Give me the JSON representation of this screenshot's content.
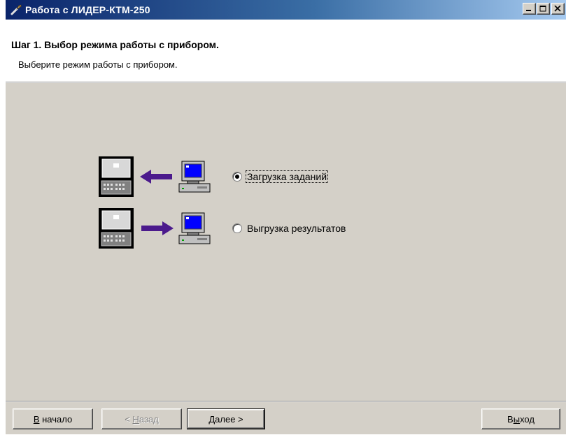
{
  "window": {
    "title": "Работа с ЛИДЕР-КТМ-250",
    "controls": [
      "minimize-icon",
      "maximize-icon",
      "close-icon"
    ]
  },
  "header": {
    "title": "Шаг 1. Выбор режима работы с прибором.",
    "subtitle": "Выберите режим работы с прибором."
  },
  "options": [
    {
      "label": "Загрузка заданий",
      "selected": true,
      "icons": [
        "device-icon",
        "arrow-left-icon",
        "computer-icon"
      ]
    },
    {
      "label": "Выгрузка результатов",
      "selected": false,
      "icons": [
        "device-icon",
        "arrow-right-icon",
        "computer-icon"
      ]
    }
  ],
  "buttons": {
    "home": {
      "mnemonic": "В",
      "rest": " начало",
      "enabled": true
    },
    "back": {
      "prefix": "< ",
      "mnemonic": "Н",
      "rest": "азад",
      "enabled": false
    },
    "next": {
      "mnemonic": "Д",
      "rest": "алее >",
      "enabled": true,
      "default": true
    },
    "exit": {
      "prefix": "В",
      "mnemonic": "ы",
      "rest": "ход",
      "enabled": true
    }
  },
  "colors": {
    "titlebar_start": "#0a246a",
    "titlebar_end": "#a6caf0",
    "arrow": "#4b1a8c",
    "dialog_bg": "#d4d0c8"
  }
}
